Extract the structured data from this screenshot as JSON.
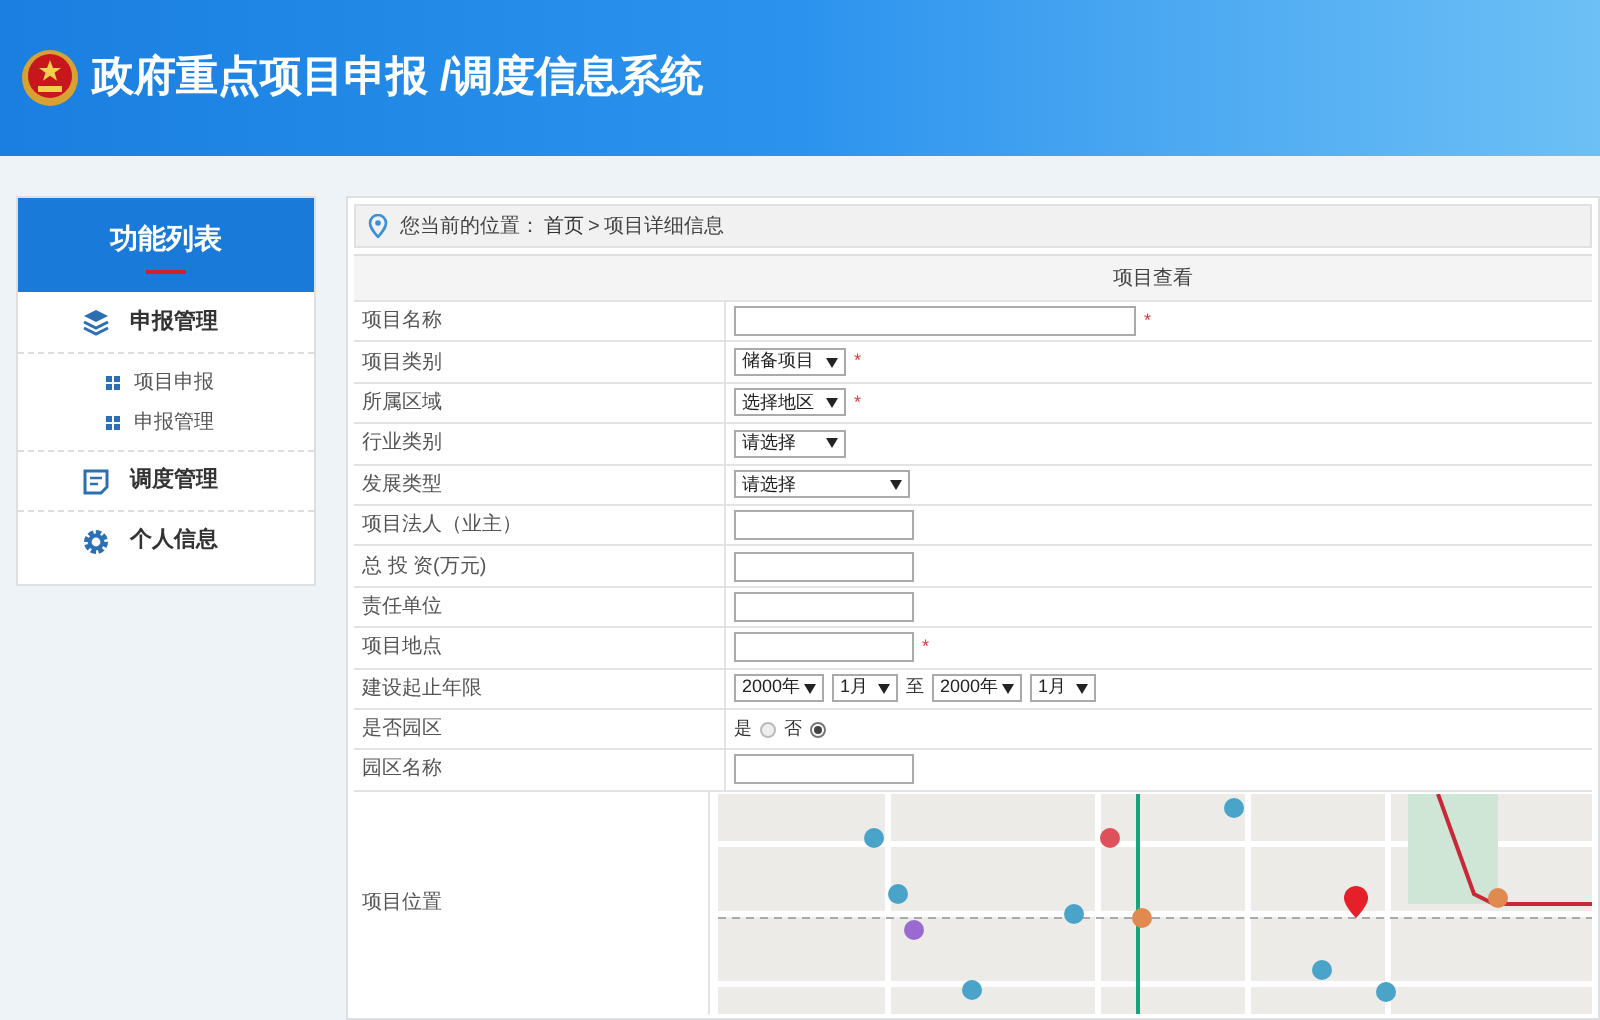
{
  "header": {
    "title": "政府重点项目申报 /调度信息系统"
  },
  "sidebar": {
    "title": "功能列表",
    "items": [
      {
        "label": "申报管理",
        "children": [
          {
            "label": "项目申报"
          },
          {
            "label": "申报管理"
          }
        ]
      },
      {
        "label": "调度管理"
      },
      {
        "label": "个人信息"
      }
    ]
  },
  "breadcrumb": {
    "prefix": "您当前的位置：",
    "home": "首页",
    "separator": ">",
    "current": "项目详细信息"
  },
  "form": {
    "title": "项目查看",
    "rows": [
      {
        "label": "项目名称",
        "kind": "input",
        "wide": true,
        "mark": "*"
      },
      {
        "label": "项目类别",
        "kind": "select",
        "value": "储备项目",
        "mark": "*"
      },
      {
        "label": "所属区域",
        "kind": "select",
        "value": "选择地区",
        "mark": "*"
      },
      {
        "label": "行业类别",
        "kind": "select",
        "value": "请选择"
      },
      {
        "label": "发展类型",
        "kind": "select",
        "value": "请选择",
        "wide": true
      },
      {
        "label": "项目法人（业主）",
        "kind": "input"
      },
      {
        "label": "总 投 资(万元)",
        "kind": "input"
      },
      {
        "label": "责任单位",
        "kind": "input"
      },
      {
        "label": "项目地点",
        "kind": "input",
        "mark": "*"
      },
      {
        "label": "建设起止年限",
        "kind": "daterange",
        "start": [
          "2000年",
          "1月"
        ],
        "joiner": "至",
        "end": [
          "2000年",
          "1月"
        ]
      },
      {
        "label": "是否园区",
        "kind": "radio",
        "options": [
          {
            "label": "是",
            "selected": false
          },
          {
            "label": "否",
            "selected": true
          }
        ]
      },
      {
        "label": "园区名称",
        "kind": "input"
      },
      {
        "label": "项目位置",
        "kind": "map"
      }
    ]
  }
}
